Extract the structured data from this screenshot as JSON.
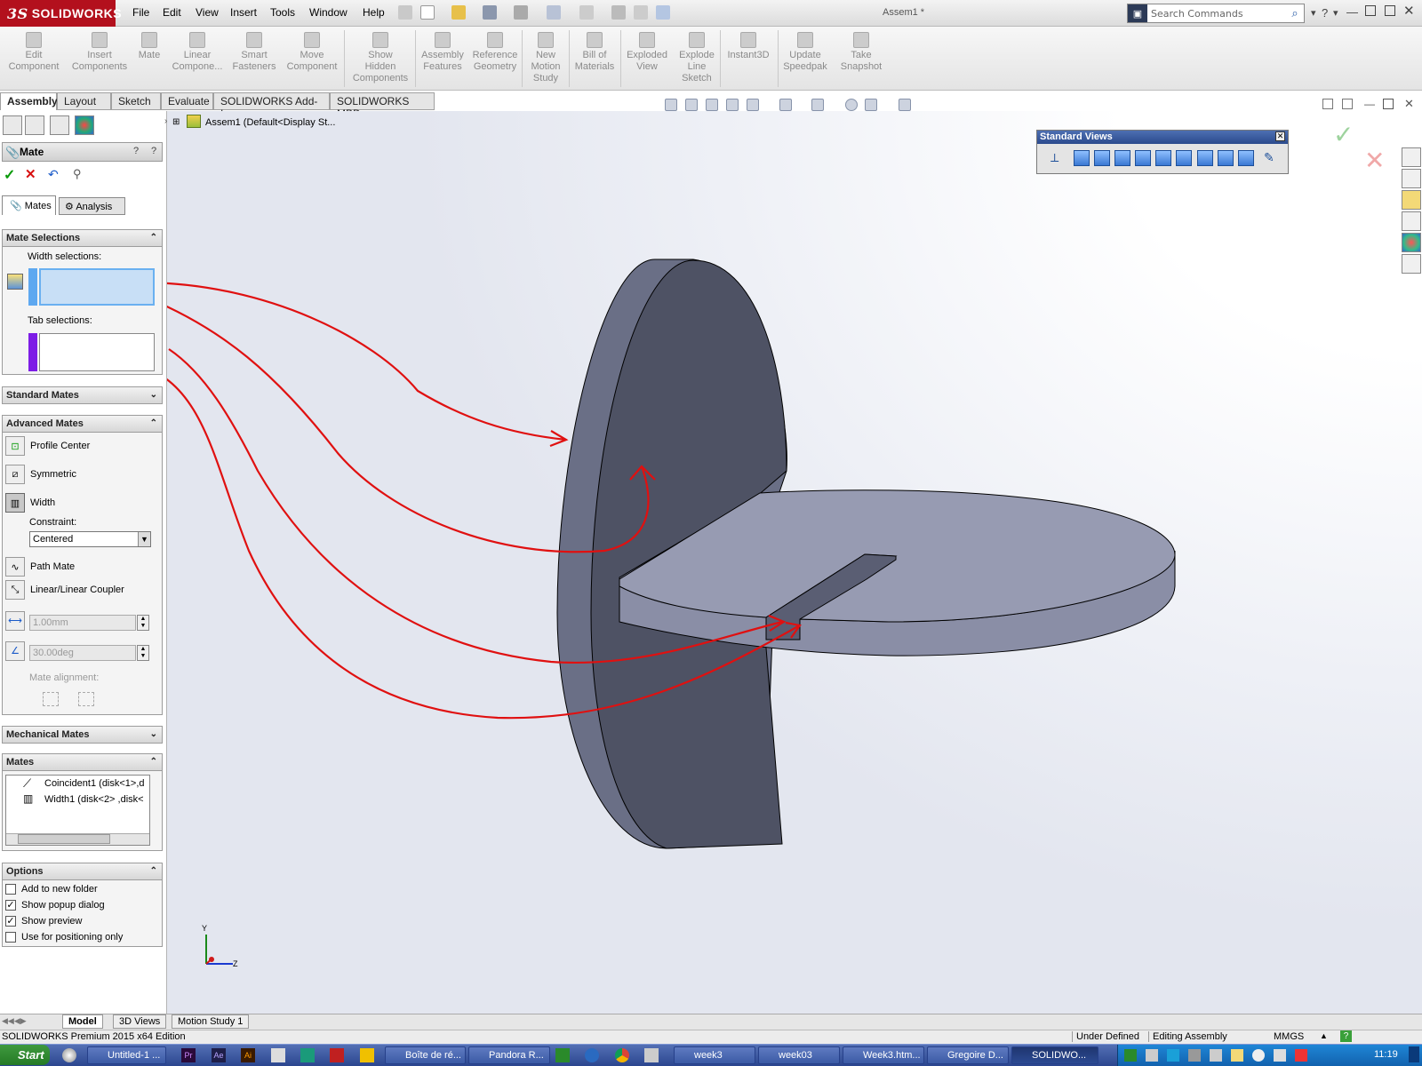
{
  "app": {
    "logo_text": "SOLIDWORKS",
    "logo_ds": "3S",
    "window_title": "Assem1 *",
    "menu": [
      "File",
      "Edit",
      "View",
      "Insert",
      "Tools",
      "Window",
      "Help"
    ],
    "search_placeholder": "Search Commands",
    "accent": "#b3101d"
  },
  "ribbon": {
    "buttons": [
      {
        "label": "Edit\nComponent"
      },
      {
        "label": "Insert\nComponents"
      },
      {
        "label": "Mate"
      },
      {
        "label": "Linear\nCompone..."
      },
      {
        "label": "Smart\nFasteners"
      },
      {
        "label": "Move\nComponent"
      },
      {
        "label": "Show\nHidden\nComponents"
      },
      {
        "label": "Assembly\nFeatures"
      },
      {
        "label": "Reference\nGeometry"
      },
      {
        "label": "New\nMotion\nStudy"
      },
      {
        "label": "Bill of\nMaterials"
      },
      {
        "label": "Exploded\nView"
      },
      {
        "label": "Explode\nLine\nSketch"
      },
      {
        "label": "Instant3D"
      },
      {
        "label": "Update\nSpeedpak"
      },
      {
        "label": "Take\nSnapshot"
      }
    ]
  },
  "tabs": [
    "Assembly",
    "Layout",
    "Sketch",
    "Evaluate",
    "SOLIDWORKS Add-Ins",
    "SOLIDWORKS MBD"
  ],
  "tree": {
    "root": "Assem1  (Default<Display St..."
  },
  "panel": {
    "title": "Mate",
    "subtabs": [
      "Mates",
      "Analysis"
    ],
    "mate_selections": {
      "header": "Mate Selections",
      "width_label": "Width selections:",
      "tab_label": "Tab selections:"
    },
    "standard_mates": "Standard Mates",
    "advanced": {
      "header": "Advanced Mates",
      "items": [
        "Profile Center",
        "Symmetric",
        "Width"
      ],
      "constraint_label": "Constraint:",
      "constraint_value": "Centered",
      "items2": [
        "Path Mate",
        "Linear/Linear Coupler"
      ],
      "distance": "1.00mm",
      "angle": "30.00deg",
      "alignment": "Mate alignment:"
    },
    "mechanical": "Mechanical Mates",
    "mates": {
      "header": "Mates",
      "list": [
        "Coincident1 (disk<1>,d",
        "Width1 (disk<2> ,disk<"
      ]
    },
    "options": {
      "header": "Options",
      "items": [
        {
          "label": "Add to new folder",
          "checked": false
        },
        {
          "label": "Show popup dialog",
          "checked": true
        },
        {
          "label": "Show preview",
          "checked": true
        },
        {
          "label": "Use for positioning only",
          "checked": false
        }
      ]
    }
  },
  "std_views": {
    "title": "Standard Views"
  },
  "triad": {
    "y": "Y",
    "z": "Z"
  },
  "bottom_tabs": [
    "Model",
    "3D Views",
    "Motion Study 1"
  ],
  "status": {
    "left": "SOLIDWORKS Premium 2015 x64 Edition",
    "defined": "Under Defined",
    "mode": "Editing Assembly",
    "units": "MMGS"
  },
  "taskbar": {
    "start": "Start",
    "items": [
      "Untitled-1 ...",
      "Boîte de ré...",
      "Pandora R...",
      "week3",
      "week03",
      "Week3.htm...",
      "Gregoire D...",
      "SOLIDWO..."
    ],
    "clock": "11:19"
  }
}
